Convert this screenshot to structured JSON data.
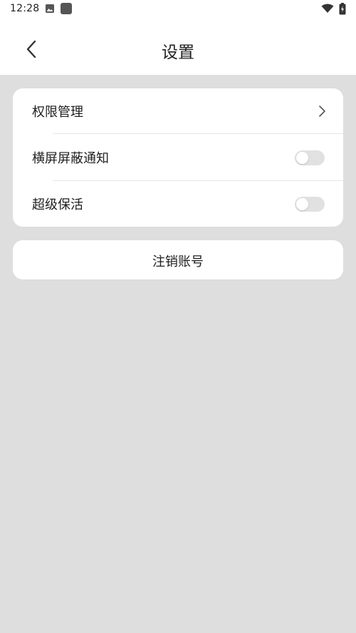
{
  "status_bar": {
    "time": "12:28",
    "icons": [
      "image-icon",
      "app-icon",
      "wifi-icon",
      "battery-icon"
    ]
  },
  "header": {
    "title": "设置",
    "back_icon": "chevron-left-icon"
  },
  "settings": {
    "items": [
      {
        "label": "权限管理",
        "control": "chevron-right-icon"
      },
      {
        "label": "横屏屏蔽通知",
        "control": "toggle",
        "on": false
      },
      {
        "label": "超级保活",
        "control": "toggle",
        "on": false
      }
    ]
  },
  "logout": {
    "label": "注销账号"
  },
  "colors": {
    "background": "#dedede",
    "surface": "#ffffff",
    "text": "#202020",
    "toggle_off": "#e1e1e1",
    "divider": "#e6e6e6"
  }
}
